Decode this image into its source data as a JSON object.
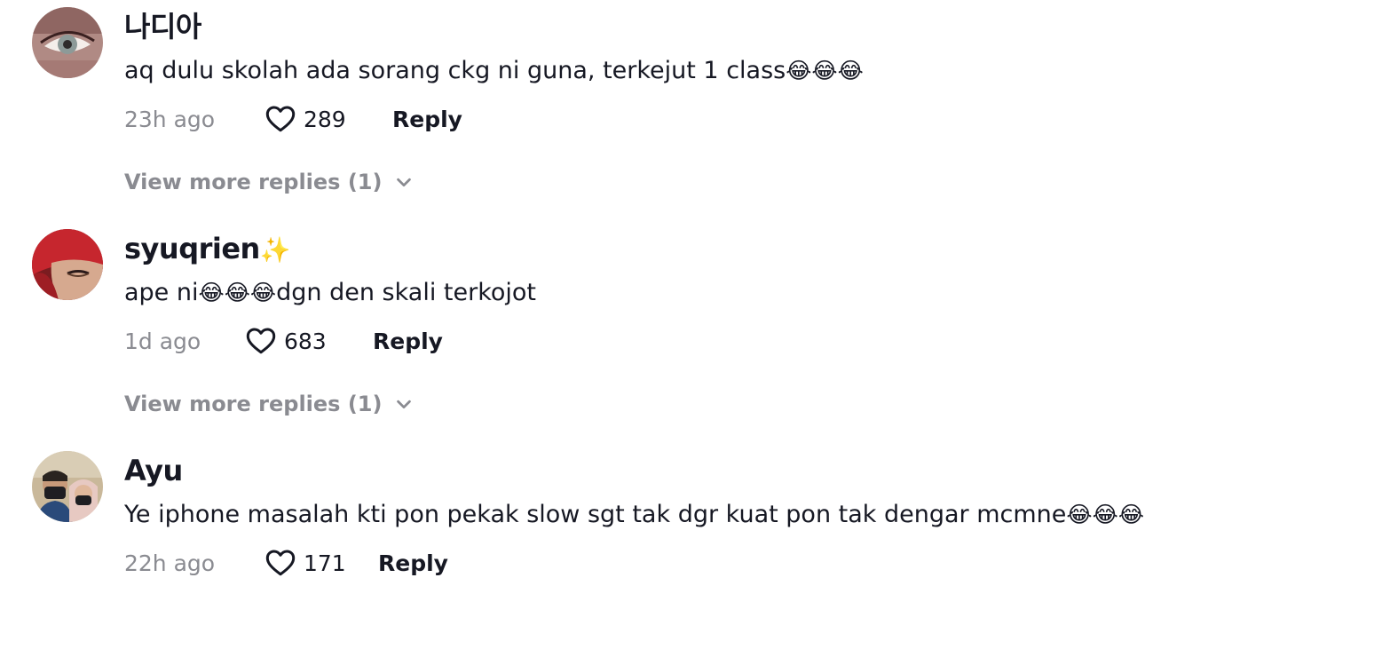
{
  "comments": [
    {
      "username": "나디아",
      "username_badge": "",
      "text": "aq dulu skolah ada sorang ckg ni guna, terkejut 1 class",
      "text_tail": "",
      "emojis": "😂😂😂",
      "time": "23h ago",
      "likes": "289",
      "reply_label": "Reply",
      "view_more": "View more replies (1)",
      "avatar_icon": "avatar-eye-makeup",
      "accent": "#9a6b6b"
    },
    {
      "username": "syuqrien",
      "username_badge": "✨",
      "text": "ape ni",
      "text_tail": "dgn den skali terkojot",
      "emojis": "😂😂😂",
      "time": "1d ago",
      "likes": "683",
      "reply_label": "Reply",
      "view_more": "View more replies (1)",
      "avatar_icon": "avatar-red-headscarf",
      "accent": "#c6262e"
    },
    {
      "username": "Ayu",
      "username_badge": "",
      "text": "Ye iphone masalah kti pon pekak slow sgt tak dgr kuat pon tak dengar mcmne",
      "text_tail": "",
      "emojis": "😂😂😂",
      "time": "22h ago",
      "likes": "171",
      "reply_label": "Reply",
      "view_more": "",
      "avatar_icon": "avatar-couple-photo",
      "accent": "#2a4a7a"
    }
  ],
  "colors": {
    "text_primary": "#161823",
    "text_secondary": "#8a8b91",
    "background": "#ffffff"
  }
}
